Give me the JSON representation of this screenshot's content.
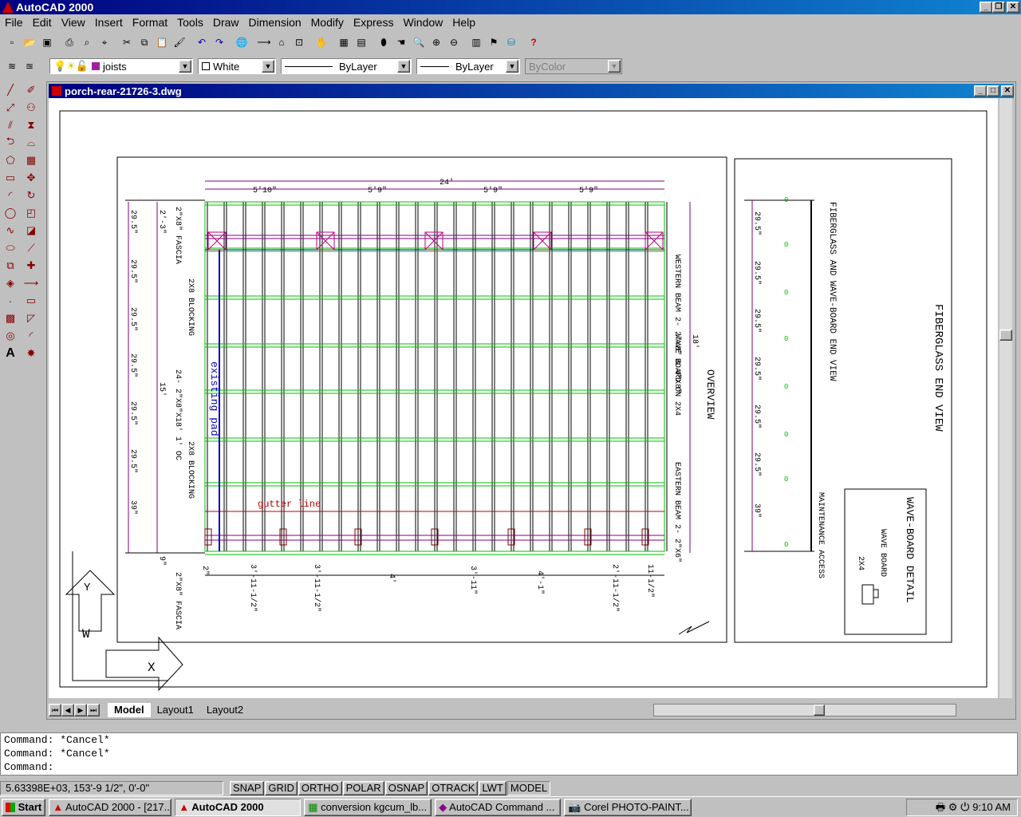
{
  "app": {
    "title": "AutoCAD 2000"
  },
  "menu": [
    "File",
    "Edit",
    "View",
    "Insert",
    "Format",
    "Tools",
    "Draw",
    "Dimension",
    "Modify",
    "Express",
    "Window",
    "Help"
  ],
  "layers": {
    "current_layer": "joists",
    "color": "White",
    "linetype": "ByLayer",
    "lineweight": "ByLayer",
    "plotstyle": "ByColor"
  },
  "drawing": {
    "title": "porch-rear-21726-3.dwg",
    "overall_width": "24'",
    "top_dims": [
      "5'10\"",
      "5'9\"",
      "5'9\"",
      "5'9\""
    ],
    "left_dims": [
      "29.5\"",
      "29.5\"",
      "29.5\"",
      "29.5\"",
      "29.5\"",
      "29.5\"",
      "39\"",
      "9\""
    ],
    "left_span_a": "2'-3\"",
    "left_span_b": "15'",
    "right_span": "18'",
    "bottom_dims": [
      "2\"",
      "3'-11-1/2\"",
      "3'-11-1/2\"",
      "4'",
      "3'-11\"",
      "4'-1\"",
      "2'-11-1/2\"",
      "11-1/2\""
    ],
    "labels": {
      "fascia_top": "2\"X8\" FASCIA",
      "blocking_top": "2X8 BLOCKING",
      "joists": "24- 2\"X8\"X18' 1' OC",
      "blocking_bottom": "2X8 BLOCKING",
      "fascia_bottom": "2\"X8\" FASCIA",
      "existing": "existing pad",
      "gutter": "gutter line",
      "western_beam": "WESTERN BEAM 2- 2\"X8\" & 4\"X8\"",
      "wave_board": "WAVE BOARD ON 2X4",
      "eastern_beam": "EASTERN BEAM 2- 2\"X6\"",
      "overview": "OVERVIEW",
      "fiberglass_wave_end": "FIBERGLASS AND WAVE-BOARD END VIEW",
      "fiberglass_end": "FIBERGLASS END VIEW",
      "maintenance": "MAINTENANCE ACCESS",
      "wave_detail": "WAVE-BOARD DETAIL",
      "wave_board_small": "WAVE BOARD",
      "two_by_four": "2X4"
    },
    "end_dims": [
      "29.5\"",
      "29.5\"",
      "29.5\"",
      "29.5\"",
      "29.5\"",
      "29.5\"",
      "39\""
    ]
  },
  "tabs": [
    "Model",
    "Layout1",
    "Layout2"
  ],
  "command": {
    "line1": "Command: *Cancel*",
    "line2": "Command: *Cancel*",
    "prompt": "Command:"
  },
  "status": {
    "coords": "5.63398E+03, 153'-9 1/2\", 0'-0\"",
    "toggles": [
      "SNAP",
      "GRID",
      "ORTHO",
      "POLAR",
      "OSNAP",
      "OTRACK",
      "LWT",
      "MODEL"
    ]
  },
  "taskbar": {
    "start": "Start",
    "tasks": [
      "AutoCAD 2000 - [217...",
      "AutoCAD 2000",
      "conversion kgcum_lb...",
      "AutoCAD Command ...",
      "Corel PHOTO-PAINT..."
    ],
    "clock": "9:10 AM"
  }
}
